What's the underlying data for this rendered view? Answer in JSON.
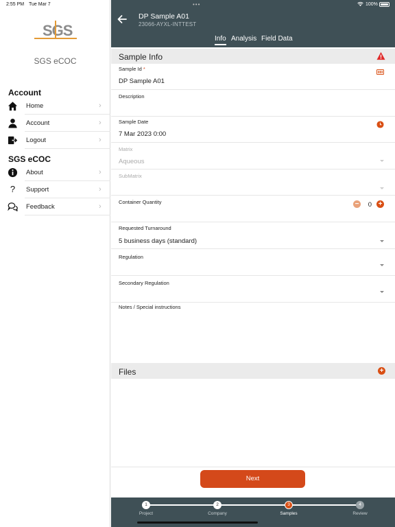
{
  "status_bar": {
    "time": "2:55 PM",
    "date": "Tue Mar 7",
    "battery": "100%"
  },
  "sidebar": {
    "logo_text": "SGS",
    "app_name": "SGS eCOC",
    "sections": [
      {
        "heading": "Account",
        "items": [
          {
            "label": "Home",
            "icon": "home-icon"
          },
          {
            "label": "Account",
            "icon": "person-icon"
          },
          {
            "label": "Logout",
            "icon": "logout-icon"
          }
        ]
      },
      {
        "heading": "SGS eCOC",
        "items": [
          {
            "label": "About",
            "icon": "info-icon"
          },
          {
            "label": "Support",
            "icon": "question-icon"
          },
          {
            "label": "Feedback",
            "icon": "chat-bubbles-icon"
          }
        ]
      }
    ]
  },
  "header": {
    "title": "DP Sample A01",
    "subtitle": "23066-AYXL-INTTEST",
    "tabs": [
      {
        "label": "Info",
        "active": true
      },
      {
        "label": "Analysis",
        "active": false
      },
      {
        "label": "Field Data",
        "active": false
      }
    ]
  },
  "sample_info": {
    "title": "Sample Info",
    "sample_id": {
      "label": "Sample Id",
      "required": "*",
      "value": "DP Sample A01"
    },
    "description": {
      "label": "Description",
      "value": ""
    },
    "sample_date": {
      "label": "Sample Date",
      "value": "7 Mar 2023 0:00"
    },
    "matrix": {
      "label": "Matrix",
      "value": "Aqueous"
    },
    "submatrix": {
      "label": "SubMatrix",
      "value": ""
    },
    "container_quantity": {
      "label": "Container Quantity",
      "value": "0"
    },
    "requested_turnaround": {
      "label": "Requested Turnaround",
      "value": "5 business days (standard)"
    },
    "regulation": {
      "label": "Regulation",
      "value": ""
    },
    "secondary_regulation": {
      "label": "Secondary Regulation",
      "value": ""
    },
    "notes": {
      "label": "Notes / Special instructions",
      "value": ""
    }
  },
  "files": {
    "title": "Files"
  },
  "next_label": "Next",
  "steps": [
    {
      "number": "1",
      "label": "Project",
      "state": "done"
    },
    {
      "number": "2",
      "label": "Company",
      "state": "done"
    },
    {
      "number": "3",
      "label": "Samples",
      "state": "active"
    },
    {
      "number": "4",
      "label": "Review",
      "state": "upcoming"
    }
  ],
  "colors": {
    "header": "#3f5056",
    "accent": "#d94f14",
    "warning": "#e02b2b",
    "logo_accent": "#e39a35"
  }
}
